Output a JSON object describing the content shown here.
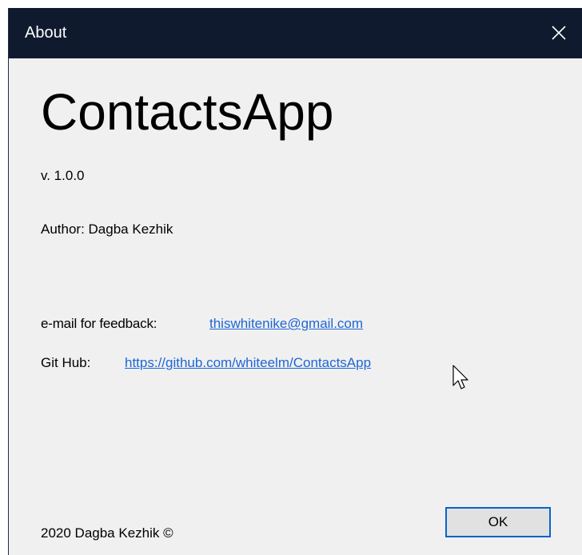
{
  "window": {
    "title": "About",
    "close_icon": "close-icon"
  },
  "content": {
    "app_name": "ContactsApp",
    "version": "v. 1.0.0",
    "author": "Author: Dagba Kezhik",
    "feedback_label": "e-mail for feedback:",
    "feedback_email": "thiswhitenike@gmail.com",
    "github_label": "Git Hub:",
    "github_url": "https://github.com/whiteelm/ContactsApp",
    "copyright": "2020 Dagba Kezhik ©"
  },
  "buttons": {
    "ok_label": "OK"
  },
  "colors": {
    "titlebar": "#101a2f",
    "link": "#1d66d6",
    "button_focus_border": "#0a63c9"
  }
}
